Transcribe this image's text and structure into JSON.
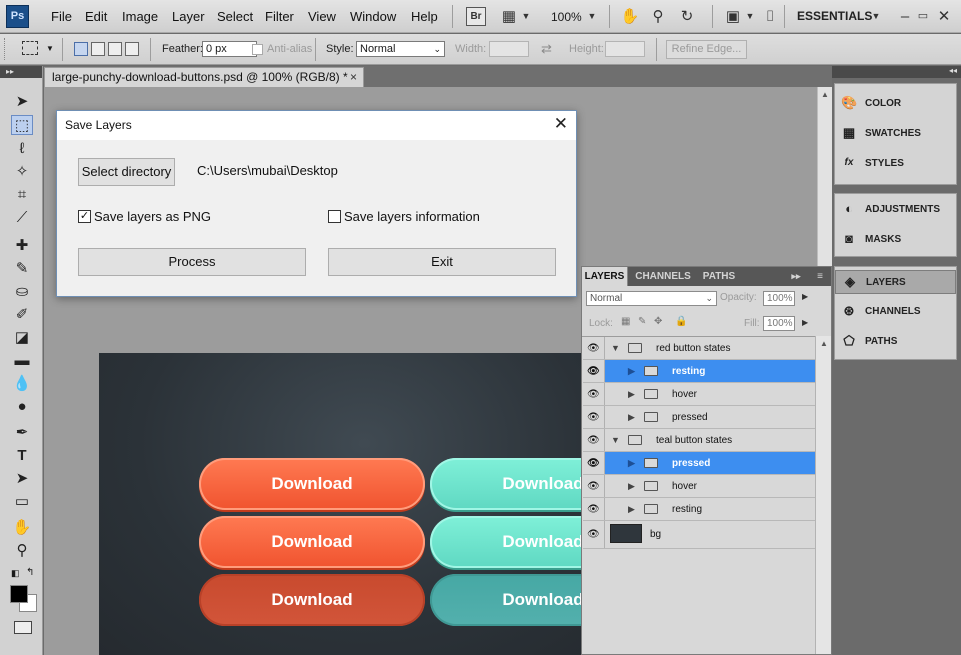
{
  "menubar": {
    "logo": "Ps",
    "items": [
      "File",
      "Edit",
      "Image",
      "Layer",
      "Select",
      "Filter",
      "View",
      "Window",
      "Help"
    ],
    "bridge": "Br",
    "zoom": "100%",
    "workspace": "ESSENTIALS",
    "icons": [
      "hand-icon",
      "zoom-icon",
      "rotate-view-icon",
      "arrange-documents-icon",
      "screen-mode-icon"
    ]
  },
  "options": {
    "feather_label": "Feather:",
    "feather_value": "0 px",
    "antialias_label": "Anti-alias",
    "style_label": "Style:",
    "style_value": "Normal",
    "width_label": "Width:",
    "height_label": "Height:",
    "refine_edge": "Refine Edge..."
  },
  "document": {
    "tab_title": "large-punchy-download-buttons.psd @ 100% (RGB/8) *",
    "close_glyph": "×"
  },
  "canvas": {
    "buttons": [
      {
        "label": "Download",
        "style": "red-resting"
      },
      {
        "label": "Download",
        "style": "teal-resting"
      },
      {
        "label": "Download",
        "style": "red-hover"
      },
      {
        "label": "Download",
        "style": "teal-hover"
      },
      {
        "label": "Download",
        "style": "red-pressed"
      },
      {
        "label": "Download",
        "style": "teal-pressed"
      }
    ]
  },
  "dialog": {
    "title": "Save Layers",
    "select_directory": "Select directory",
    "directory_path": "C:\\Users\\mubai\\Desktop",
    "save_png_label": "Save layers as PNG",
    "save_png_checked": true,
    "save_info_label": "Save layers information",
    "save_info_checked": false,
    "process": "Process",
    "exit": "Exit"
  },
  "layers_panel": {
    "tabs": [
      "LAYERS",
      "CHANNELS",
      "PATHS"
    ],
    "blend_mode": "Normal",
    "opacity_label": "Opacity:",
    "opacity_value": "100%",
    "lock_label": "Lock:",
    "fill_label": "Fill:",
    "fill_value": "100%",
    "layers": [
      {
        "name": "red button states",
        "type": "group",
        "expanded": true,
        "indent": 0,
        "selected": false
      },
      {
        "name": "resting",
        "type": "group",
        "expanded": false,
        "indent": 1,
        "selected": true
      },
      {
        "name": "hover",
        "type": "group",
        "expanded": false,
        "indent": 1,
        "selected": false
      },
      {
        "name": "pressed",
        "type": "group",
        "expanded": false,
        "indent": 1,
        "selected": false
      },
      {
        "name": "teal button states",
        "type": "group",
        "expanded": true,
        "indent": 0,
        "selected": false
      },
      {
        "name": "pressed",
        "type": "group",
        "expanded": false,
        "indent": 1,
        "selected": true
      },
      {
        "name": "hover",
        "type": "group",
        "expanded": false,
        "indent": 1,
        "selected": false
      },
      {
        "name": "resting",
        "type": "group",
        "expanded": false,
        "indent": 1,
        "selected": false
      },
      {
        "name": "bg",
        "type": "layer",
        "expanded": false,
        "indent": 0,
        "selected": false
      }
    ]
  },
  "dock": {
    "group1": [
      "COLOR",
      "SWATCHES",
      "STYLES"
    ],
    "group2": [
      "ADJUSTMENTS",
      "MASKS"
    ],
    "group3": [
      "LAYERS",
      "CHANNELS",
      "PATHS"
    ],
    "active": "LAYERS"
  },
  "colors": {
    "selection_blue": "#3d8ef0",
    "red_button": "#f0532f",
    "teal_button": "#5fd8c2"
  }
}
